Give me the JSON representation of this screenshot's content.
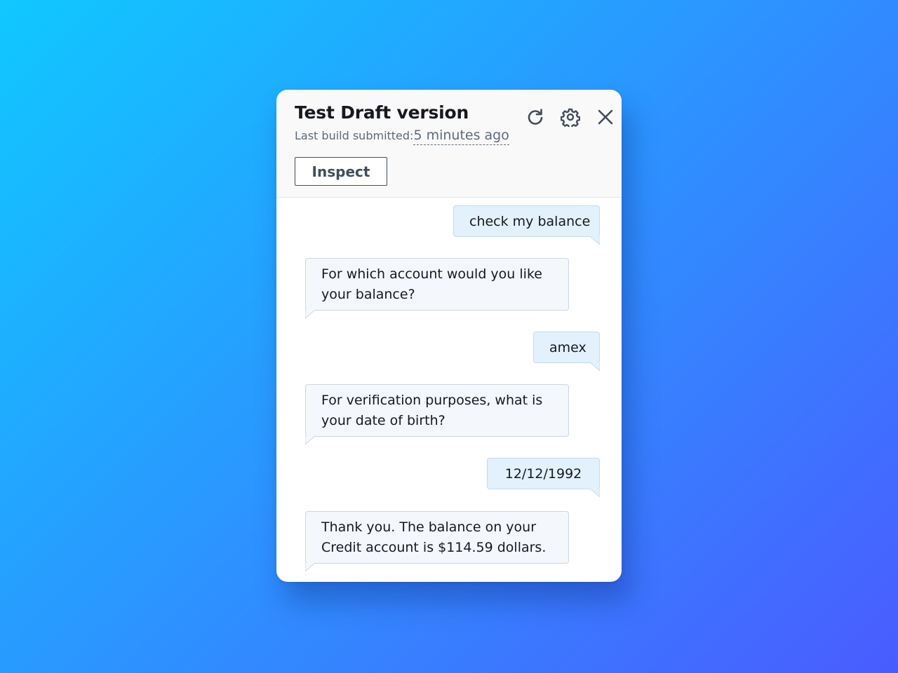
{
  "header": {
    "title": "Test Draft version",
    "subtitle_prefix": "Last build submitted:",
    "subtitle_time": "5 minutes ago",
    "inspect_label": "Inspect",
    "icons": [
      "refresh-icon",
      "gear-icon",
      "close-icon"
    ]
  },
  "messages": [
    {
      "role": "user",
      "text": "check my balance"
    },
    {
      "role": "bot",
      "text": "For which account would you like your balance?"
    },
    {
      "role": "user",
      "text": "amex"
    },
    {
      "role": "bot",
      "text": "For verification purposes, what is your date of birth?"
    },
    {
      "role": "user",
      "text": "12/12/1992"
    },
    {
      "role": "bot",
      "text": "Thank you. The balance on your Credit account is $114.59 dollars."
    }
  ],
  "colors": {
    "user_bubble": "#e3f1fd",
    "bot_bubble": "#f4f8fc",
    "text": "#16191f",
    "muted": "#5f6b7a"
  }
}
